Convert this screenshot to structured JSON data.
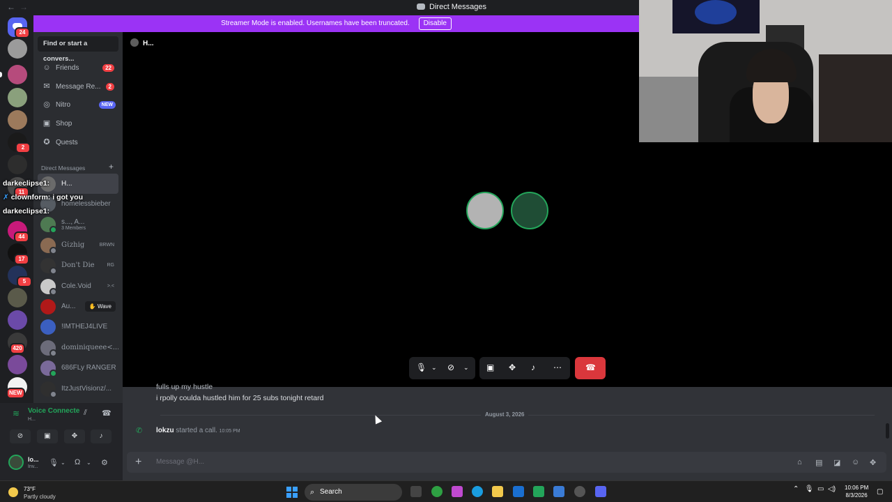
{
  "titlebar": {
    "title": "Direct Messages",
    "back": "←",
    "forward": "→"
  },
  "banner": {
    "text": "Streamer Mode is enabled. Usernames have been truncated.",
    "disable_label": "Disable"
  },
  "rail": {
    "badges": [
      {
        "count": "24"
      },
      {
        "count": "2"
      },
      {
        "count": "11"
      },
      {
        "count": "44"
      },
      {
        "count": "17"
      },
      {
        "count": "5"
      },
      {
        "count": "420"
      },
      {
        "count": "NEW"
      }
    ]
  },
  "sidebar": {
    "search_placeholder": "Find or start a convers...",
    "nav": [
      {
        "label": "Friends",
        "count": "22",
        "icon": "friends-icon"
      },
      {
        "label": "Message Re...",
        "count": "2",
        "icon": "envelope-icon"
      },
      {
        "label": "Nitro",
        "tag": "NEW",
        "icon": "nitro-icon"
      },
      {
        "label": "Shop",
        "icon": "shop-icon"
      },
      {
        "label": "Quests",
        "icon": "quests-icon"
      }
    ],
    "dm_header": "Direct Messages",
    "dm_add": "+",
    "dms": [
      {
        "name": "H...",
        "color": "#6b6b6b"
      },
      {
        "name": "homelessbieber",
        "color": "#565c63"
      },
      {
        "name": "s..., A...",
        "sub": "3 Members",
        "color": "#4e7a52"
      },
      {
        "name": "Gίzhig",
        "tag": "BRWN",
        "color": "#8a6a52"
      },
      {
        "name": "Don't Die",
        "tag": "RG",
        "color": "#333333"
      },
      {
        "name": "Cole.Void",
        "tag": ">.<",
        "color": "#c9c9c9"
      },
      {
        "name": "Au...",
        "action": "Wave",
        "color": "#b01919"
      },
      {
        "name": "!IMTHEJ4LIVE",
        "color": "#3b5fc0"
      },
      {
        "name": "dominiqueee<...",
        "color": "#6c6c7a"
      },
      {
        "name": "686FLy RANGER",
        "color": "#7a6a9a"
      },
      {
        "name": "ItzJustVisionz/...",
        "color": "#2f2f2f"
      }
    ]
  },
  "overlay_chat": [
    {
      "user": "darkeclipse1:",
      "text": ""
    },
    {
      "user": "clownform:",
      "text": "i got you"
    },
    {
      "user": "darkeclipse1:",
      "text": ""
    }
  ],
  "voice": {
    "status": "Voice Connecte",
    "channel": "H...",
    "user_name": "lo...",
    "user_status": "Inv..."
  },
  "main": {
    "header": "H..."
  },
  "chat": {
    "partial_message": "fulls up my hustle",
    "message": "i rpolly coulda hustled him for 25 subs tonight retard",
    "date": "August 3, 2026",
    "call_user": "lokzu",
    "call_text": "started a call.",
    "call_time": "10:05 PM",
    "composer_placeholder": "Message @H..."
  },
  "taskbar": {
    "temp": "73°F",
    "condition": "Partly cloudy",
    "search": "Search",
    "time": "10:06 PM",
    "date": "8/3/2026"
  },
  "colors": {
    "accent": "#9b33f5",
    "online": "#23a55a",
    "danger": "#f23f43",
    "blurple": "#5865f2"
  }
}
